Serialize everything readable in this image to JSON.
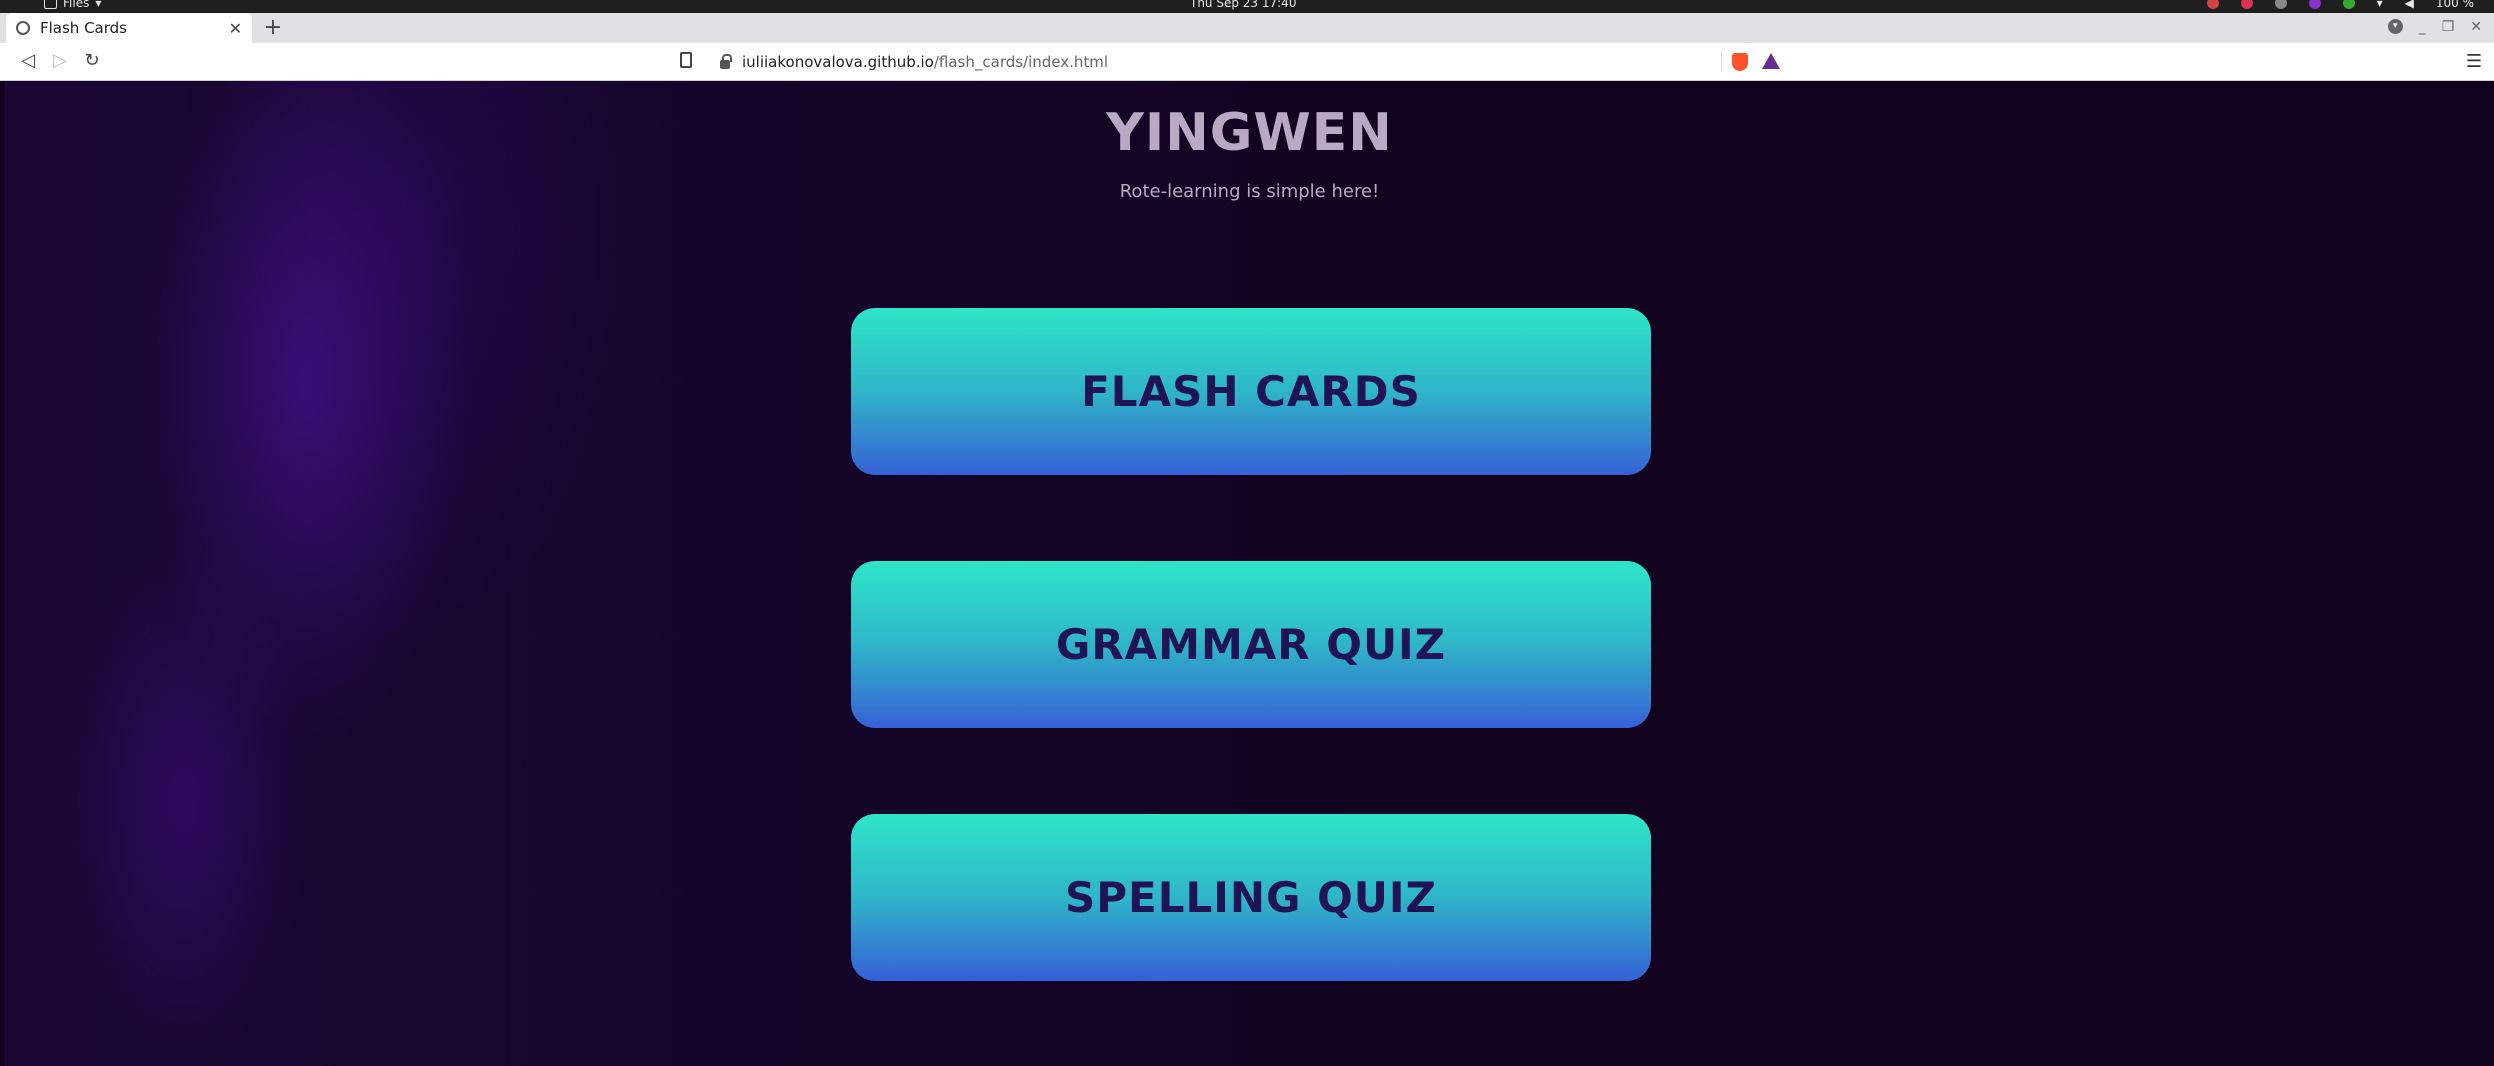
{
  "os": {
    "app_menu": "Files",
    "clock": "Thu Sep 23  17:40",
    "battery": "100 %"
  },
  "browser": {
    "tab_title": "Flash Cards",
    "new_tab": "+",
    "close_tab": "✕",
    "url_host": "iuliiakonovalova.github.io",
    "url_path": "/flash_cards/index.html"
  },
  "page": {
    "title": "YINGWEN",
    "tagline": "Rote-learning is simple here!",
    "buttons": [
      {
        "label": "FLASH CARDS"
      },
      {
        "label": "GRAMMAR QUIZ"
      },
      {
        "label": "SPELLING QUIZ"
      }
    ]
  },
  "colors": {
    "background": "#12041f",
    "button_top": "#2ee6c8",
    "button_bottom": "#3661d6",
    "button_text": "#1e1456",
    "title_text": "#b9a9c3"
  }
}
